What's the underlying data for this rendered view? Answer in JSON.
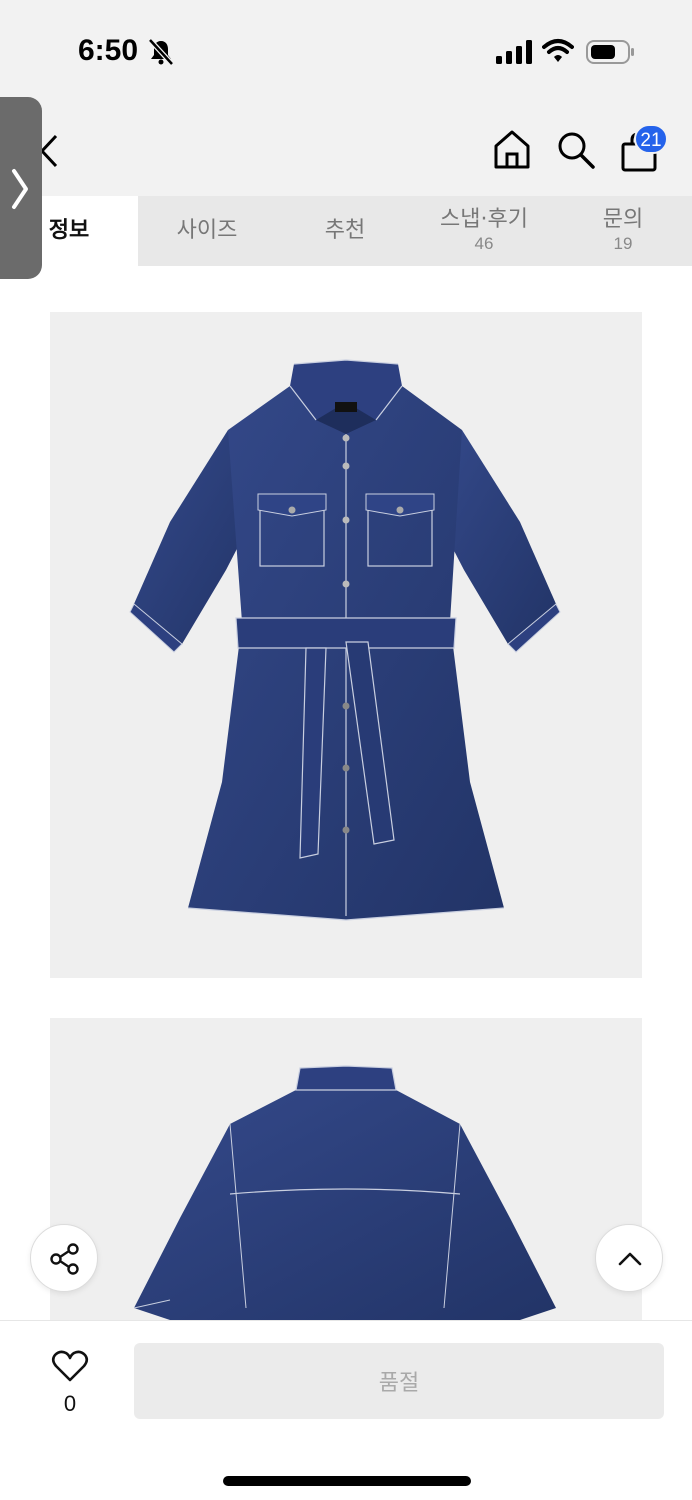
{
  "status_bar": {
    "time": "6:50"
  },
  "header": {
    "cart_count": "21"
  },
  "tabs": [
    {
      "label": "정보",
      "count": ""
    },
    {
      "label": "사이즈",
      "count": ""
    },
    {
      "label": "추천",
      "count": ""
    },
    {
      "label": "스냅·후기",
      "count": "46"
    },
    {
      "label": "문의",
      "count": "19"
    }
  ],
  "bottom_bar": {
    "like_count": "0",
    "buy_label": "품절"
  },
  "colors": {
    "accent": "#2563eb",
    "denim": "#2b3f78"
  }
}
